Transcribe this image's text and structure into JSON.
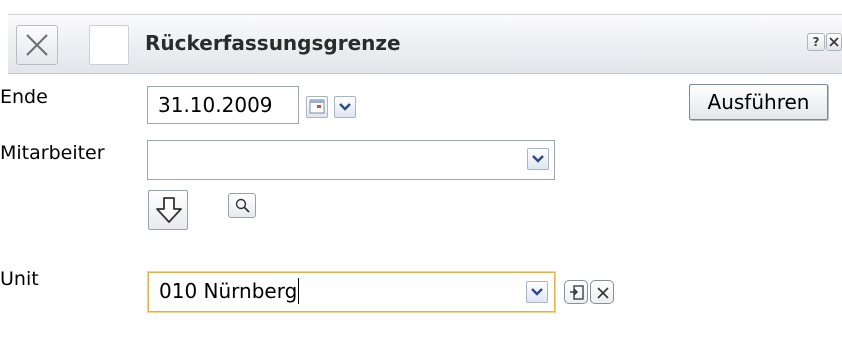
{
  "dialog": {
    "title": "Rückerfassungsgrenze",
    "help_label": "?"
  },
  "form": {
    "end": {
      "label": "Ende",
      "value": "31.10.2009"
    },
    "employee": {
      "label": "Mitarbeiter",
      "value": ""
    },
    "unit": {
      "label": "Unit",
      "value": "010 Nürnberg"
    },
    "execute_label": "Ausführen"
  },
  "icons": {
    "close": "close-icon",
    "calendar": "calendar-icon",
    "dropdown": "chevron-down-icon",
    "down_arrow": "arrow-down-icon",
    "search": "magnifier-icon",
    "goto": "goto-icon",
    "clear": "clear-icon"
  },
  "colors": {
    "title_bar": "#ecedf1",
    "field_border": "#9aa6b8",
    "focus_border": "#e2b24d",
    "chevron": "#2b4a8a"
  }
}
